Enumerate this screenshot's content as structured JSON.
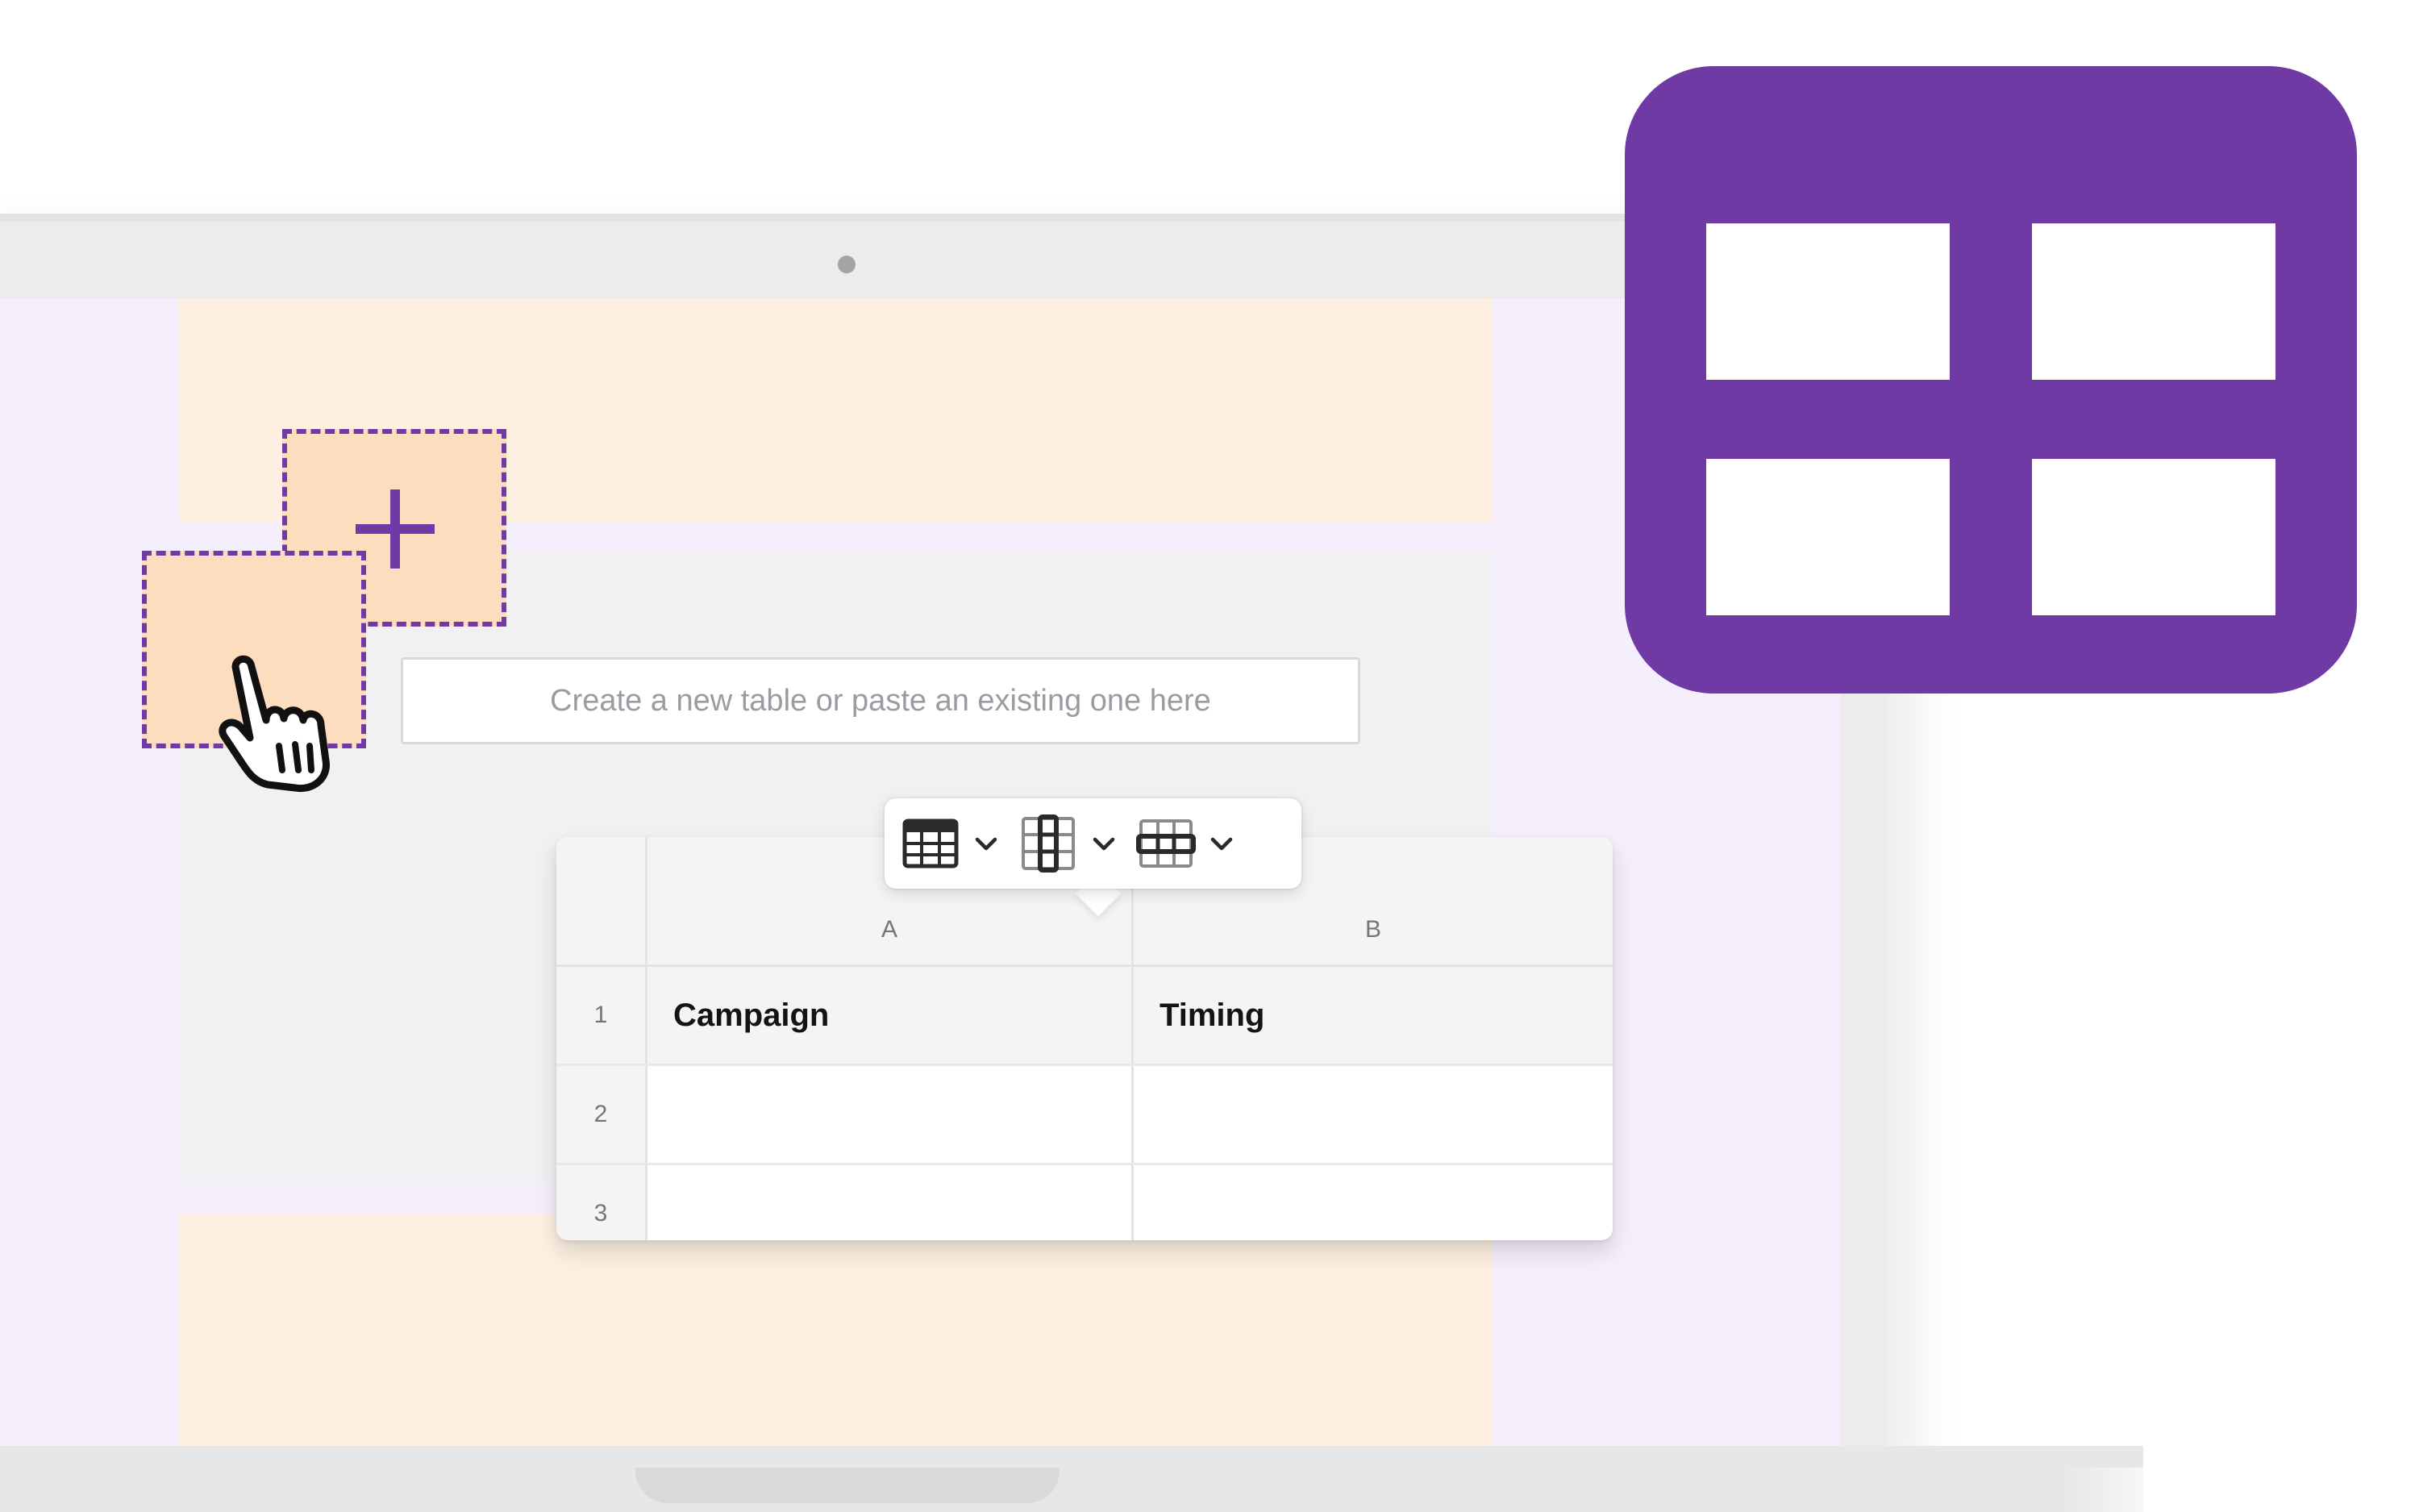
{
  "colors": {
    "brand_purple": "#6f3aa3",
    "screen_background": "#f5effd",
    "doc_block": "#fdf0e2",
    "dashed_block_fill": "#fcdebe",
    "editor_area": "#f1f1f3"
  },
  "add_block": {
    "icon": "plus-icon"
  },
  "cursor": {
    "icon": "hand-pointer-icon"
  },
  "table_input": {
    "placeholder": "Create a new table or paste an existing one here"
  },
  "toolbar": {
    "buttons": [
      {
        "icon": "table-grid-icon",
        "dropdown_icon": "chevron-down-icon"
      },
      {
        "icon": "table-column-icon",
        "dropdown_icon": "chevron-down-icon"
      },
      {
        "icon": "table-row-icon",
        "dropdown_icon": "chevron-down-icon"
      }
    ]
  },
  "table": {
    "columns": [
      "A",
      "B"
    ],
    "rows": [
      {
        "number": "1",
        "cells": [
          "Campaign",
          "Timing"
        ]
      },
      {
        "number": "2",
        "cells": [
          "",
          ""
        ]
      },
      {
        "number": "3",
        "cells": [
          "",
          ""
        ]
      }
    ]
  },
  "logo": {
    "icon": "table-icon"
  }
}
